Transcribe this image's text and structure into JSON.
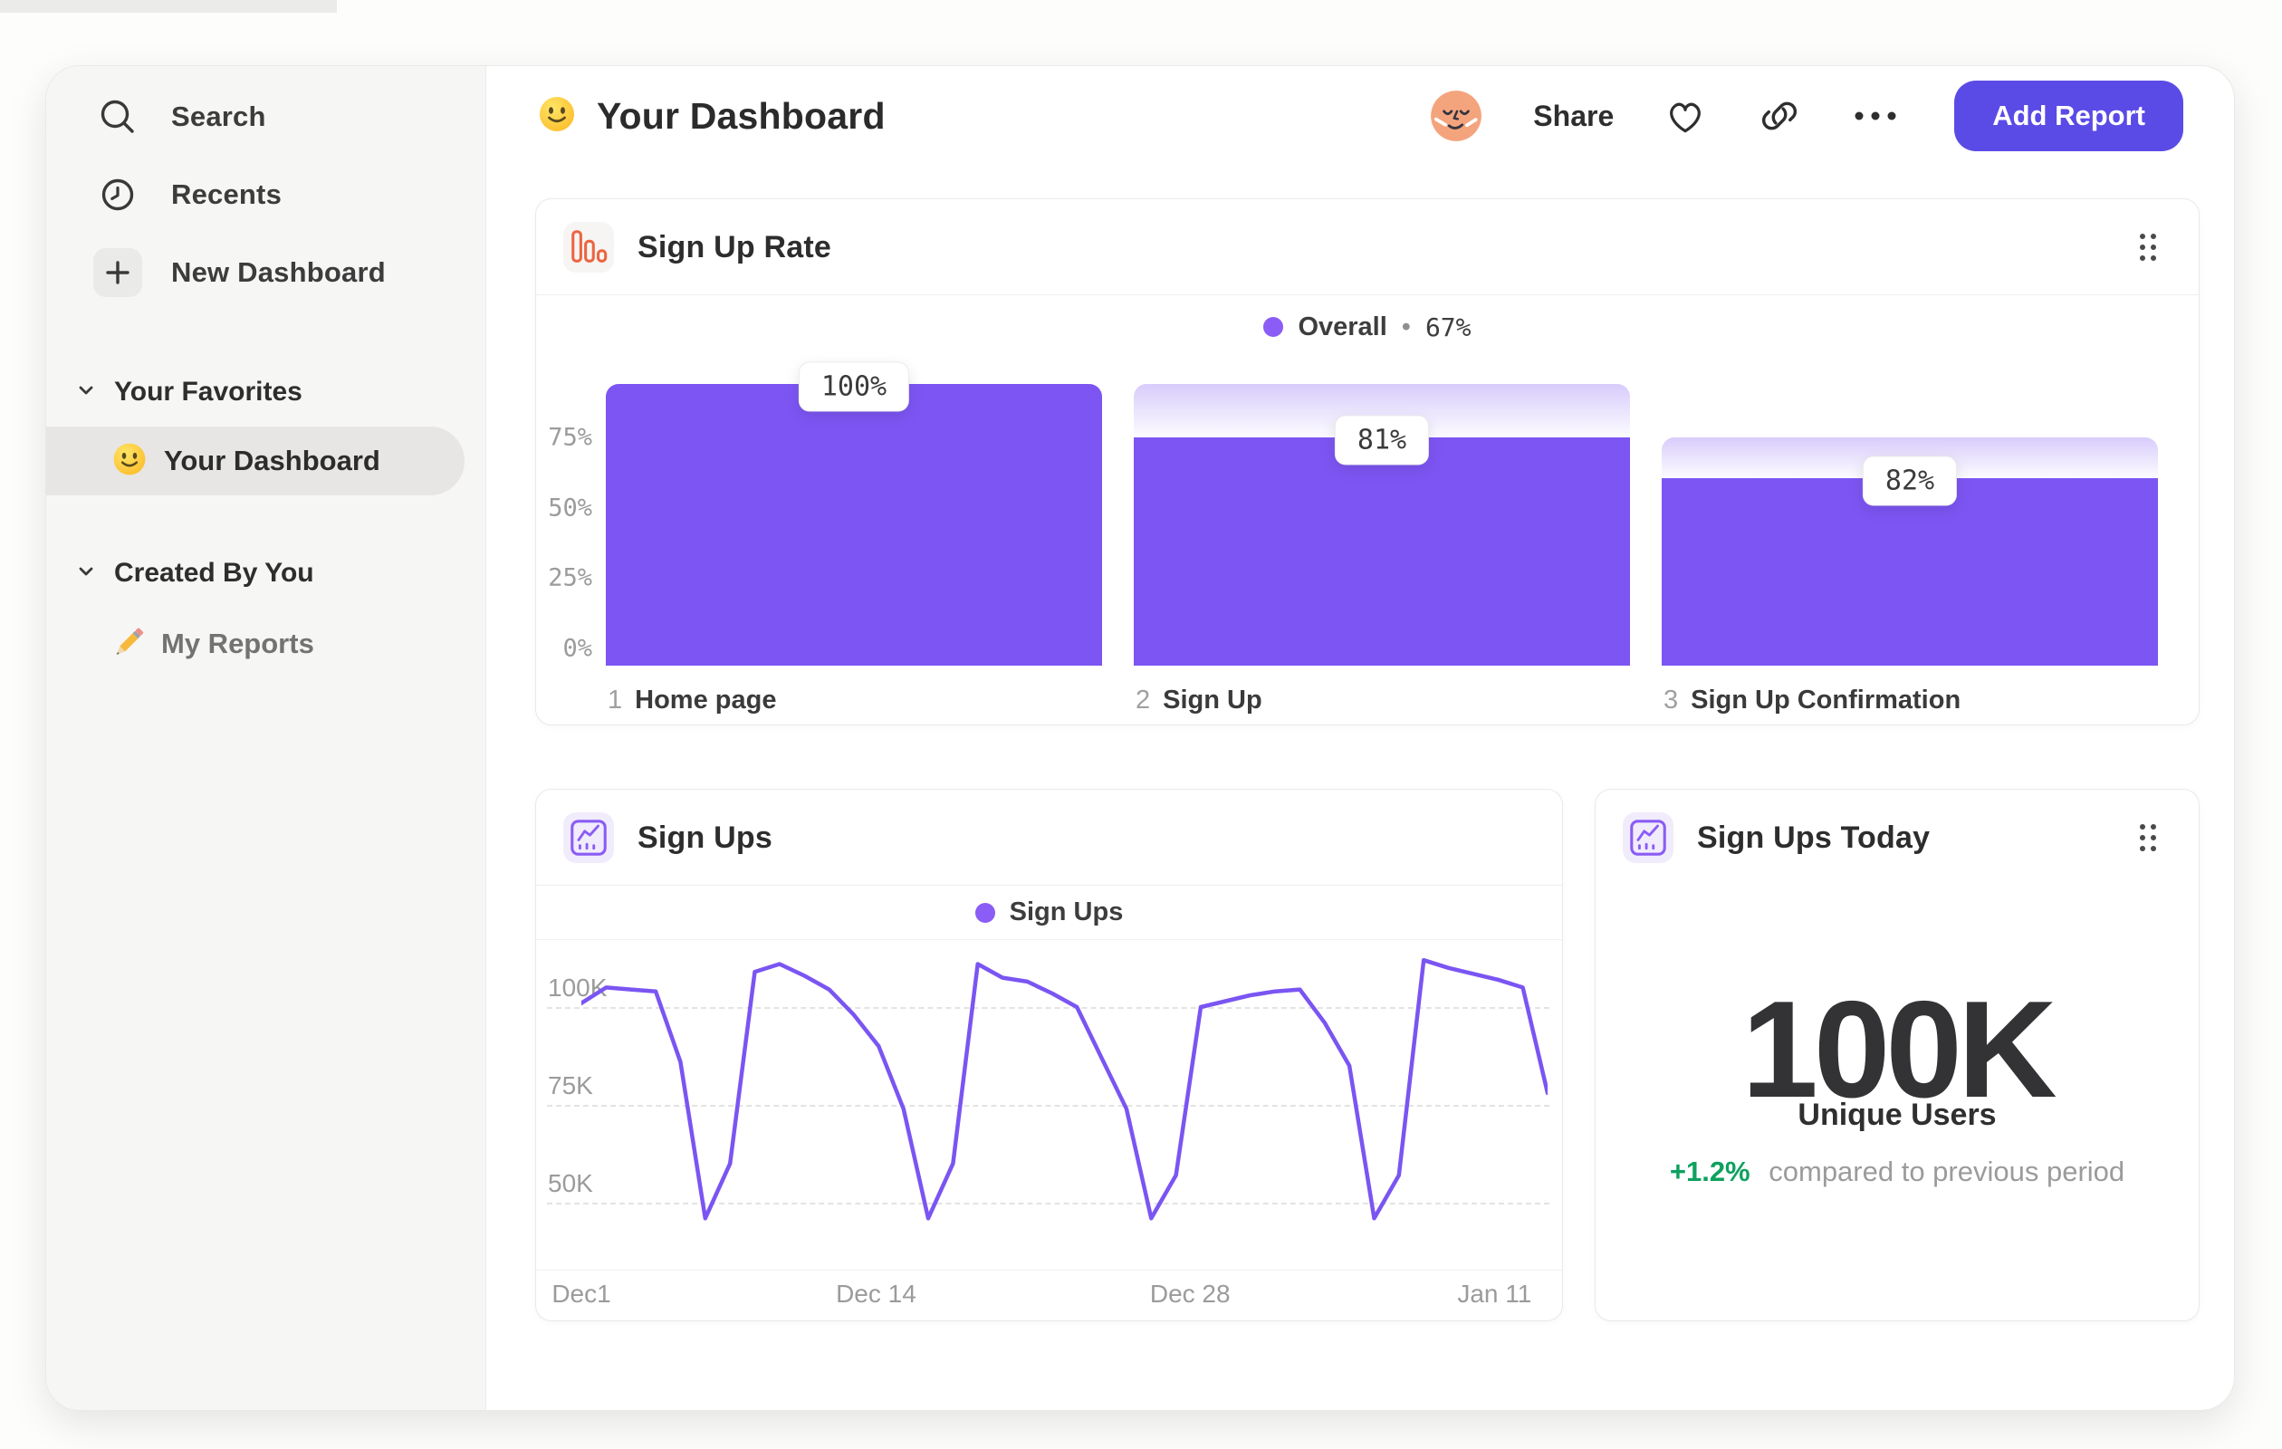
{
  "sidebar": {
    "top_items": [
      {
        "label": "Search",
        "icon": "search-icon"
      },
      {
        "label": "Recents",
        "icon": "clock-icon"
      },
      {
        "label": "New Dashboard",
        "icon": "plus-icon"
      }
    ],
    "sections": [
      {
        "title": "Your Favorites",
        "items": [
          {
            "label": "Your Dashboard",
            "icon": "smiley-icon",
            "selected": true
          }
        ]
      },
      {
        "title": "Created By You",
        "items": [
          {
            "label": "My Reports",
            "icon": "pencil-icon",
            "selected": false
          }
        ]
      }
    ]
  },
  "header": {
    "title": "Your Dashboard",
    "actions": {
      "share": "Share",
      "add_report": "Add Report"
    }
  },
  "funnel_card": {
    "title": "Sign Up Rate",
    "legend": {
      "name": "Overall",
      "separator": "•",
      "value": "67%"
    }
  },
  "line_card": {
    "title": "Sign Ups",
    "legend": {
      "name": "Sign Ups"
    }
  },
  "kpi_card": {
    "title": "Sign Ups Today",
    "value": "100K",
    "label": "Unique Users",
    "delta": "+1.2%",
    "delta_note": "compared to previous period"
  },
  "colors": {
    "bar_purple": "#7d55f3",
    "line_purple": "#7a55f2",
    "legend_dot": "#8b5cf6",
    "button_purple": "#5a4be7",
    "icon_orange": "#ec6541",
    "delta_green": "#0ea15e"
  },
  "chart_data": [
    {
      "type": "bar",
      "title": "Sign Up Rate",
      "subtitle_legend": "Overall • 67%",
      "categories": [
        "Home page",
        "Sign Up",
        "Sign Up Confirmation"
      ],
      "step_numbers": [
        "1",
        "2",
        "3"
      ],
      "values": [
        100,
        81,
        82
      ],
      "value_labels": [
        "100%",
        "81%",
        "82%"
      ],
      "cumulative_pct": [
        100,
        81,
        66.4
      ],
      "y_ticks": [
        {
          "label": "75%",
          "value": 75
        },
        {
          "label": "50%",
          "value": 50
        },
        {
          "label": "25%",
          "value": 25
        },
        {
          "label": "0%",
          "value": 0
        }
      ],
      "ylim": [
        0,
        100
      ],
      "legend_position": "top-center",
      "grid": "off"
    },
    {
      "type": "line",
      "title": "Sign Ups",
      "series": [
        {
          "name": "Sign Ups",
          "unit": "K",
          "values": [
            101,
            105,
            104.5,
            104,
            86,
            46,
            60,
            109,
            111,
            108,
            104.5,
            98,
            90,
            74,
            46,
            60,
            111,
            107.5,
            106.5,
            103.5,
            100,
            87,
            74,
            46,
            57,
            100,
            101.5,
            103,
            104,
            104.5,
            96,
            85,
            46,
            57,
            112,
            110,
            108.5,
            107,
            105,
            78
          ]
        }
      ],
      "x_ticks": [
        {
          "label": "Dec1",
          "fraction": 0
        },
        {
          "label": "Dec 14",
          "fraction": 0.305
        },
        {
          "label": "Dec 28",
          "fraction": 0.63
        },
        {
          "label": "Jan 11",
          "fraction": 0.945
        }
      ],
      "y_ticks": [
        {
          "label": "100K",
          "value": 100
        },
        {
          "label": "75K",
          "value": 75
        },
        {
          "label": "50K",
          "value": 50
        }
      ],
      "ylim_k": [
        33,
        115
      ],
      "grid": "dashed-horizontal",
      "legend_position": "top-center"
    },
    {
      "type": "kpi",
      "title": "Sign Ups Today",
      "value": "100K",
      "label": "Unique Users",
      "delta_pct": 1.2,
      "delta_text": "+1.2%",
      "note": "compared to previous period"
    }
  ]
}
